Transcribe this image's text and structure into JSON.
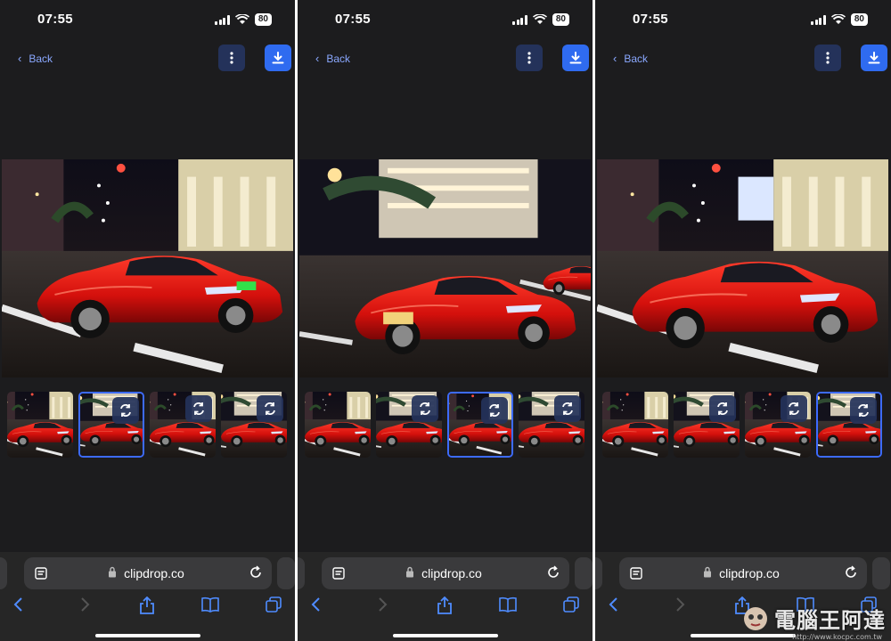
{
  "panels": [
    {
      "time": "07:55",
      "battery": "80",
      "back_label": "Back",
      "url": "clipdrop.co",
      "selected_thumb": 1
    },
    {
      "time": "07:55",
      "battery": "80",
      "back_label": "Back",
      "url": "clipdrop.co",
      "selected_thumb": 2
    },
    {
      "time": "07:55",
      "battery": "80",
      "back_label": "Back",
      "url": "clipdrop.co",
      "selected_thumb": 3
    }
  ],
  "icons": {
    "menu": "more-vertical-icon",
    "download": "download-icon",
    "regenerate": "refresh-icon",
    "back": "chevron-left-icon",
    "reader": "reader-icon",
    "lock": "lock-icon",
    "reload": "reload-icon",
    "share": "share-icon",
    "bookmarks": "book-icon",
    "tabs": "tabs-icon"
  },
  "colors": {
    "accent": "#2f6bf0",
    "link": "#8aa8ff",
    "panel_bg": "#1c1c1e",
    "toolbar_bg": "#262626"
  },
  "watermark": {
    "title": "電腦王阿達",
    "url": "http://www.kocpc.com.tw"
  }
}
